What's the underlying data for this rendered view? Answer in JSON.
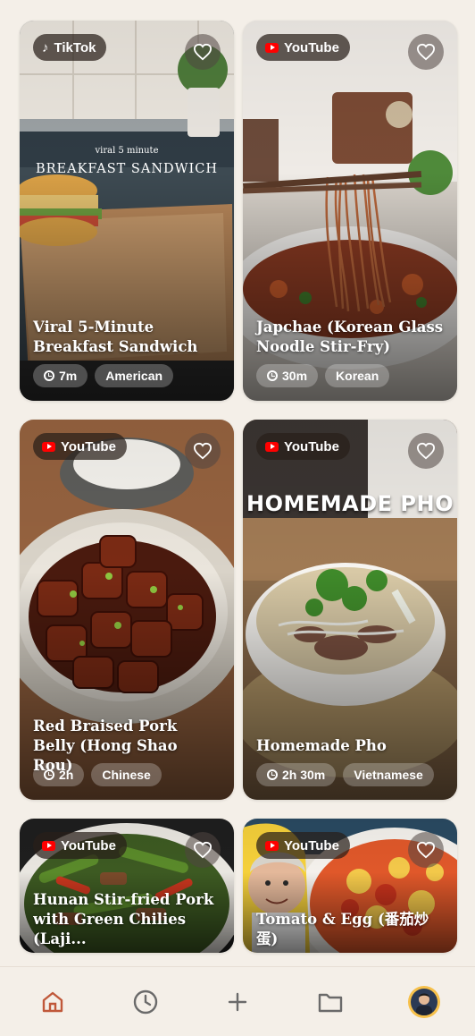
{
  "colors": {
    "background": "#f4efe8",
    "home_active": "#c0583a",
    "youtube_red": "#ff0000"
  },
  "cards": [
    {
      "source": "TikTok",
      "source_icon": "tiktok-icon",
      "overlay_small": "viral 5 minute",
      "overlay_big": "BREAKFAST SANDWICH",
      "title": "Viral 5-Minute Breakfast Sandwich",
      "time": "7m",
      "cuisine": "American"
    },
    {
      "source": "YouTube",
      "source_icon": "youtube-icon",
      "title": "Japchae (Korean Glass Noodle Stir-Fry)",
      "time": "30m",
      "cuisine": "Korean"
    },
    {
      "source": "YouTube",
      "source_icon": "youtube-icon",
      "title": "Red Braised Pork Belly (Hong Shao Rou)",
      "time": "2h",
      "cuisine": "Chinese"
    },
    {
      "source": "YouTube",
      "source_icon": "youtube-icon",
      "overlay_big": "HOMEMADE PHO",
      "title": "Homemade Pho",
      "time": "2h 30m",
      "cuisine": "Vietnamese"
    },
    {
      "source": "YouTube",
      "source_icon": "youtube-icon",
      "title": "Hunan Stir-fried Pork with Green Chilies (Laji..."
    },
    {
      "source": "YouTube",
      "source_icon": "youtube-icon",
      "title": "Tomato & Egg (番茄炒蛋)"
    }
  ],
  "nav": [
    "home-icon",
    "history-icon",
    "add-icon",
    "folder-icon",
    "profile-avatar"
  ]
}
